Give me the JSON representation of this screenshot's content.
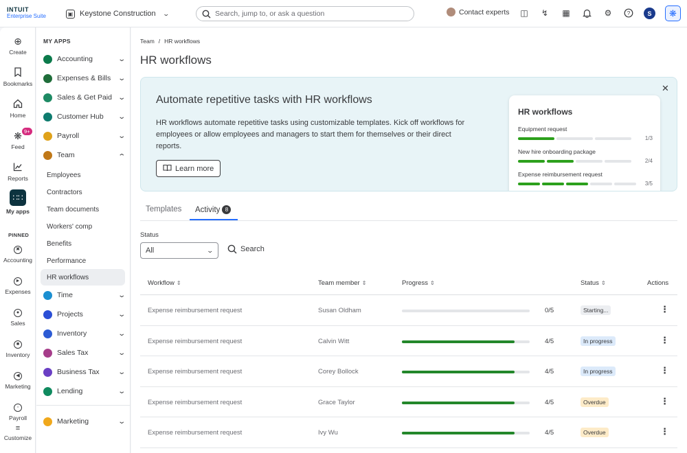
{
  "brand": {
    "line1": "INTUIT",
    "line2": "Enterprise Suite"
  },
  "company": {
    "name": "Keystone Construction"
  },
  "search": {
    "placeholder": "Search, jump to, or ask a question"
  },
  "topbar": {
    "contact": "Contact experts",
    "user_initial": "S"
  },
  "rail": {
    "items": [
      {
        "label": "Create",
        "icon": "plus-circle-icon"
      },
      {
        "label": "Bookmarks",
        "icon": "bookmark-icon"
      },
      {
        "label": "Home",
        "icon": "home-icon"
      },
      {
        "label": "Feed",
        "icon": "sparkle-icon",
        "badge": "9+"
      },
      {
        "label": "Reports",
        "icon": "chart-icon"
      },
      {
        "label": "My apps",
        "icon": "grid-icon"
      }
    ],
    "pinned_heading": "PINNED",
    "pinned": [
      {
        "label": "Accounting"
      },
      {
        "label": "Expenses"
      },
      {
        "label": "Sales"
      },
      {
        "label": "Inventory"
      },
      {
        "label": "Marketing"
      },
      {
        "label": "Payroll"
      }
    ],
    "customize": "Customize"
  },
  "apps": {
    "heading": "MY APPS",
    "items": [
      {
        "label": "Accounting",
        "color": "#0b7a4b"
      },
      {
        "label": "Expenses & Bills",
        "color": "#1f6d3a"
      },
      {
        "label": "Sales & Get Paid",
        "color": "#1e8a64"
      },
      {
        "label": "Customer Hub",
        "color": "#0e7b6e"
      },
      {
        "label": "Payroll",
        "color": "#e0a21a"
      },
      {
        "label": "Team",
        "color": "#c07818"
      }
    ],
    "team_sub": [
      "Employees",
      "Contractors",
      "Team documents",
      "Workers' comp",
      "Benefits",
      "Performance",
      "HR workflows"
    ],
    "more": [
      {
        "label": "Time",
        "color": "#1b8fd1"
      },
      {
        "label": "Projects",
        "color": "#2b4fd6"
      },
      {
        "label": "Inventory",
        "color": "#2c5bd4"
      },
      {
        "label": "Sales Tax",
        "color": "#a63d8a"
      },
      {
        "label": "Business Tax",
        "color": "#6a3fc4"
      },
      {
        "label": "Lending",
        "color": "#0f8a5f"
      }
    ],
    "marketing": {
      "label": "Marketing",
      "color": "#f0a81c"
    }
  },
  "breadcrumb": {
    "parent": "Team",
    "sep": "/",
    "current": "HR workflows"
  },
  "page": {
    "title": "HR workflows"
  },
  "banner": {
    "title": "Automate repetitive tasks with HR workflows",
    "text": "HR workflows automate repetitive tasks using customizable templates. Kick off workflows for employees or allow employees and managers to start them for themselves or their direct reports.",
    "learn_more": "Learn more",
    "card_title": "HR workflows",
    "card_items": [
      {
        "name": "Equipment request",
        "count": "1/3",
        "done": 1,
        "total": 3
      },
      {
        "name": "New hire onboarding package",
        "count": "2/4",
        "done": 2,
        "total": 4
      },
      {
        "name": "Expense reimbursement request",
        "count": "3/5",
        "done": 3,
        "total": 5
      }
    ]
  },
  "tabs": {
    "templates": "Templates",
    "activity": "Activity",
    "activity_count": "8"
  },
  "filter": {
    "status_label": "Status",
    "status_value": "All",
    "search": "Search"
  },
  "table": {
    "headers": {
      "workflow": "Workflow",
      "member": "Team member",
      "progress": "Progress",
      "status": "Status",
      "actions": "Actions"
    },
    "rows": [
      {
        "workflow": "Expense reimbursement request",
        "member": "Susan Oldham",
        "progress": 0,
        "count": "0/5",
        "status": "Starting...",
        "kind": "starting"
      },
      {
        "workflow": "Expense reimbursement request",
        "member": "Calvin Witt",
        "progress": 0.88,
        "count": "4/5",
        "status": "In progress",
        "kind": "progress"
      },
      {
        "workflow": "Expense reimbursement request",
        "member": "Corey Bollock",
        "progress": 0.88,
        "count": "4/5",
        "status": "In progress",
        "kind": "progress"
      },
      {
        "workflow": "Expense reimbursement request",
        "member": "Grace Taylor",
        "progress": 0.88,
        "count": "4/5",
        "status": "Overdue",
        "kind": "overdue"
      },
      {
        "workflow": "Expense reimbursement request",
        "member": "Ivy Wu",
        "progress": 0.88,
        "count": "4/5",
        "status": "Overdue",
        "kind": "overdue"
      }
    ]
  }
}
